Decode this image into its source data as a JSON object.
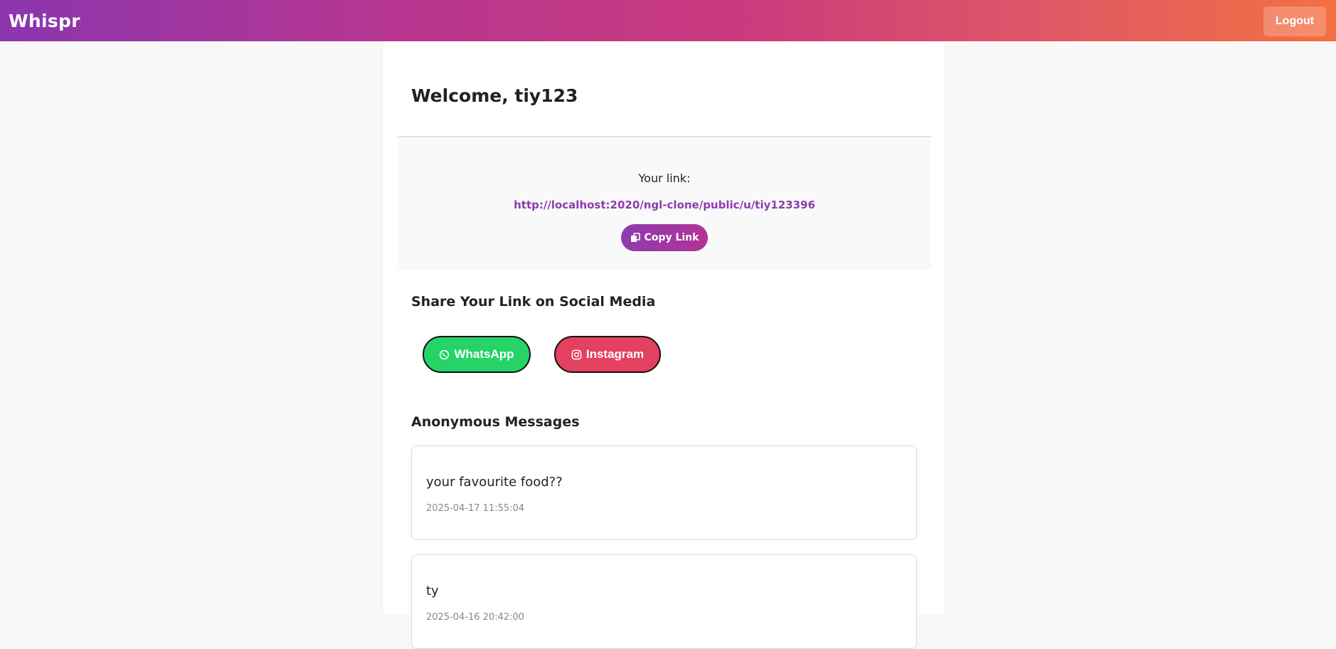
{
  "header": {
    "brand": "Whispr",
    "logout_label": "Logout"
  },
  "dashboard": {
    "welcome": "Welcome, tiy123",
    "link_label": "Your link:",
    "link_url": "http://localhost:2020/ngl-clone/public/u/tiy123396",
    "copy_label": "Copy Link",
    "copy_icon": "copy-icon"
  },
  "share": {
    "title": "Share Your Link on Social Media",
    "whatsapp_label": "WhatsApp",
    "whatsapp_icon": "whatsapp-icon",
    "whatsapp_color": "#25d366",
    "instagram_label": "Instagram",
    "instagram_icon": "instagram-icon",
    "instagram_color": "#e4405f"
  },
  "messages": {
    "title": "Anonymous Messages",
    "items": [
      {
        "text": "your favourite food??",
        "time": "2025-04-17 11:55:04"
      },
      {
        "text": "ty",
        "time": "2025-04-16 20:42:00"
      }
    ]
  },
  "colors": {
    "accent": "#8e3bb0",
    "gradient_start": "#8b35ae",
    "gradient_end": "#f4703f"
  }
}
